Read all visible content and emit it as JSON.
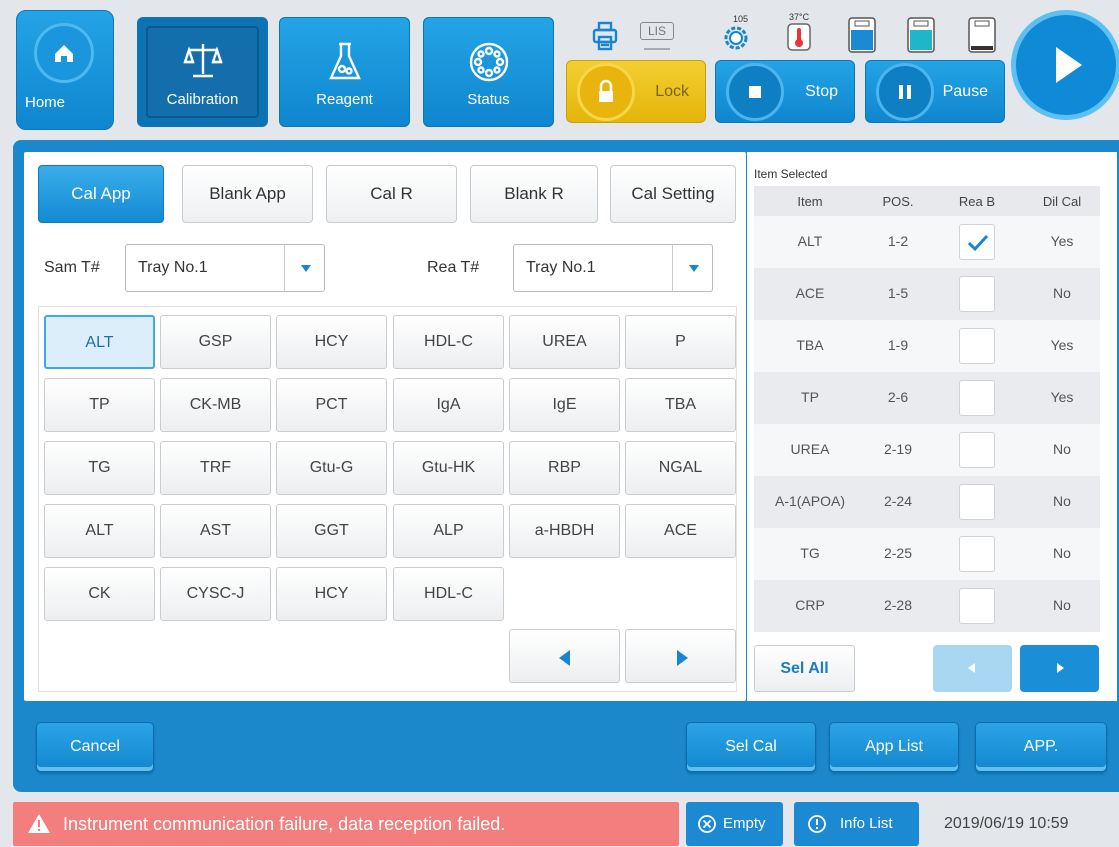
{
  "nav": {
    "home": "Home",
    "calibration": "Calibration",
    "reagent": "Reagent",
    "status": "Status"
  },
  "controls": {
    "lock": "Lock",
    "stop": "Stop",
    "pause": "Pause",
    "lis": "LIS",
    "temp_reaction": "105",
    "temp_disk": "37°C"
  },
  "tabs": [
    "Cal App",
    "Blank App",
    "Cal R",
    "Blank R",
    "Cal Setting"
  ],
  "selectors": {
    "sample_label": "Sam T#",
    "sample_value": "Tray No.1",
    "reagent_label": "Rea T#",
    "reagent_value": "Tray No.1"
  },
  "items": [
    [
      "ALT",
      "GSP",
      "HCY",
      "HDL-C",
      "UREA",
      "P"
    ],
    [
      "TP",
      "CK-MB",
      "PCT",
      "IgA",
      "IgE",
      "TBA"
    ],
    [
      "TG",
      "TRF",
      "Gtu-G",
      "Gtu-HK",
      "RBP",
      "NGAL"
    ],
    [
      "ALT",
      "AST",
      "GGT",
      "ALP",
      "a-HBDH",
      "ACE"
    ],
    [
      "CK",
      "CYSC-J",
      "HCY",
      "HDL-C"
    ]
  ],
  "selected_table": {
    "title": "Item Selected",
    "headers": [
      "Item",
      "POS.",
      "Rea B",
      "Dil Cal"
    ],
    "rows": [
      {
        "item": "ALT",
        "pos": "1-2",
        "rea_b": true,
        "dil": "Yes"
      },
      {
        "item": "ACE",
        "pos": "1-5",
        "rea_b": false,
        "dil": "No"
      },
      {
        "item": "TBA",
        "pos": "1-9",
        "rea_b": false,
        "dil": "Yes"
      },
      {
        "item": "TP",
        "pos": "2-6",
        "rea_b": false,
        "dil": "Yes"
      },
      {
        "item": "UREA",
        "pos": "2-19",
        "rea_b": false,
        "dil": "No"
      },
      {
        "item": "A-1(APOA)",
        "pos": "2-24",
        "rea_b": false,
        "dil": "No"
      },
      {
        "item": "TG",
        "pos": "2-25",
        "rea_b": false,
        "dil": "No"
      },
      {
        "item": "CRP",
        "pos": "2-28",
        "rea_b": false,
        "dil": "No"
      }
    ],
    "sel_all": "Sel All"
  },
  "actions": {
    "cancel": "Cancel",
    "sel_cal": "Sel Cal",
    "app_list": "App List",
    "app": "APP."
  },
  "status": {
    "alarm": "Instrument communication failure, data reception failed.",
    "empty": "Empty",
    "info_list": "Info List",
    "datetime": "2019/06/19 10:59"
  },
  "colors": {
    "primary": "#1586cf",
    "lock": "#f0c420",
    "alarm": "#f27e7e"
  }
}
